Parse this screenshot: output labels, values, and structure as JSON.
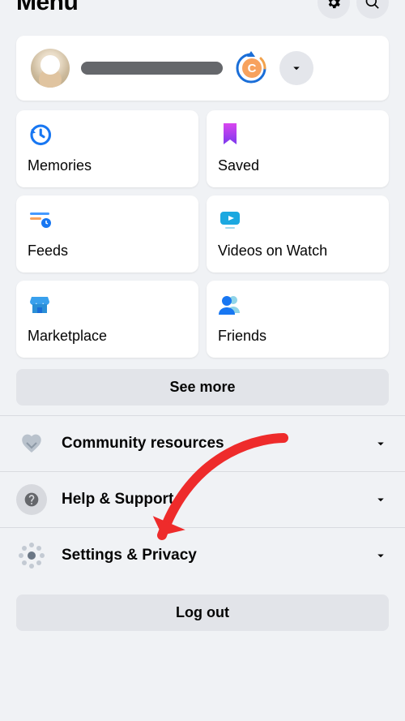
{
  "header": {
    "title": "Menu"
  },
  "profile": {
    "switch_letter": "C"
  },
  "tiles": [
    {
      "id": "memories",
      "label": "Memories"
    },
    {
      "id": "saved",
      "label": "Saved"
    },
    {
      "id": "feeds",
      "label": "Feeds"
    },
    {
      "id": "watch",
      "label": "Videos on Watch"
    },
    {
      "id": "marketplace",
      "label": "Marketplace"
    },
    {
      "id": "friends",
      "label": "Friends"
    }
  ],
  "see_more_label": "See more",
  "rows": [
    {
      "id": "community",
      "label": "Community resources"
    },
    {
      "id": "help",
      "label": "Help & Support"
    },
    {
      "id": "settings",
      "label": "Settings & Privacy"
    }
  ],
  "logout_label": "Log out",
  "colors": {
    "bg": "#f0f2f5",
    "accent_blue": "#1877f2",
    "annotation_red": "#ee2b2b"
  }
}
